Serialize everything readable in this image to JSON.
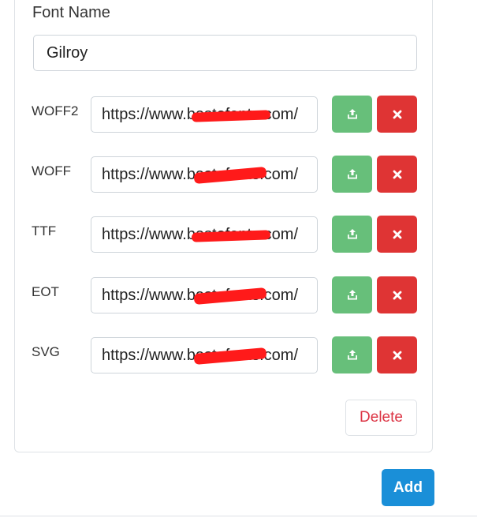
{
  "font_name": {
    "label": "Font Name",
    "value": "Gilroy"
  },
  "font_files": [
    {
      "format": "WOFF2",
      "url": "https://www.bestofonts.com/"
    },
    {
      "format": "WOFF",
      "url": "https://www.bestofonts.com/"
    },
    {
      "format": "TTF",
      "url": "https://www.bestofonts.com/"
    },
    {
      "format": "EOT",
      "url": "https://www.bestofonts.com/"
    },
    {
      "format": "SVG",
      "url": "https://www.bestofonts.com/"
    }
  ],
  "actions": {
    "upload_icon": "upload-icon",
    "remove_icon": "close-icon",
    "delete_label": "Delete",
    "add_label": "Add"
  },
  "colors": {
    "upload": "#67bf7a",
    "remove": "#df3434",
    "delete_text": "#dc3545",
    "add": "#1a8fd8",
    "redaction": "#ff1a1a"
  }
}
